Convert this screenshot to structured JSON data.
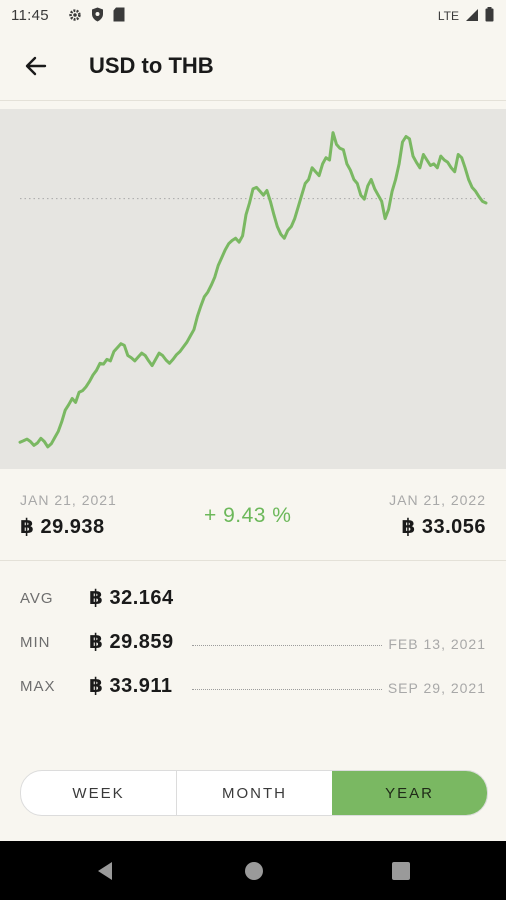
{
  "status_bar": {
    "time": "11:45",
    "network": "LTE",
    "icons": [
      "gear-icon",
      "shield-icon",
      "sd-card-icon",
      "signal-icon",
      "battery-icon"
    ]
  },
  "app_bar": {
    "title": "USD to THB",
    "back_icon": "arrow-left-icon"
  },
  "chart_data": {
    "type": "line",
    "title": "",
    "xlabel": "",
    "ylabel": "",
    "x_range": [
      "JAN 21, 2021",
      "JAN 21, 2022"
    ],
    "reference_line": 33.056,
    "color": "#7ab862",
    "series": [
      {
        "values": [
          29.94,
          29.96,
          29.98,
          29.95,
          29.9,
          29.93,
          29.99,
          29.95,
          29.88,
          29.92,
          30.0,
          30.08,
          30.2,
          30.35,
          30.42,
          30.5,
          30.45,
          30.58,
          30.6,
          30.65,
          30.72,
          30.8,
          30.86,
          30.95,
          30.94,
          31.0,
          30.98,
          31.1,
          31.15,
          31.2,
          31.18,
          31.05,
          31.02,
          30.98,
          31.03,
          31.08,
          31.05,
          30.98,
          30.92,
          31.0,
          31.08,
          31.05,
          30.99,
          30.95,
          31.0,
          31.06,
          31.1,
          31.16,
          31.22,
          31.3,
          31.38,
          31.55,
          31.68,
          31.8,
          31.86,
          31.95,
          32.05,
          32.2,
          32.3,
          32.4,
          32.48,
          32.52,
          32.55,
          32.5,
          32.58,
          32.85,
          33.0,
          33.18,
          33.2,
          33.15,
          33.1,
          33.16,
          33.02,
          32.85,
          32.7,
          32.6,
          32.55,
          32.65,
          32.7,
          32.8,
          32.95,
          33.1,
          33.25,
          33.3,
          33.45,
          33.4,
          33.35,
          33.5,
          33.58,
          33.55,
          33.9,
          33.75,
          33.7,
          33.68,
          33.5,
          33.42,
          33.3,
          33.25,
          33.1,
          33.05,
          33.22,
          33.3,
          33.18,
          33.1,
          33.02,
          32.8,
          32.92,
          33.15,
          33.3,
          33.5,
          33.78,
          33.85,
          33.82,
          33.6,
          33.52,
          33.45,
          33.62,
          33.55,
          33.48,
          33.5,
          33.45,
          33.6,
          33.55,
          33.52,
          33.45,
          33.4,
          33.62,
          33.58,
          33.45,
          33.3,
          33.2,
          33.15,
          33.08,
          33.02,
          33.0
        ]
      }
    ],
    "ylim": [
      29.7,
      34.1
    ],
    "grid": false,
    "legend": "none"
  },
  "summary": {
    "start_date": "JAN 21, 2021",
    "start_value": "฿ 29.938",
    "change": "+ 9.43 %",
    "change_color": "#6cb85a",
    "end_date": "JAN 21, 2022",
    "end_value": "฿ 33.056"
  },
  "stats": {
    "avg": {
      "label": "AVG",
      "value": "฿ 32.164"
    },
    "min": {
      "label": "MIN",
      "value": "฿ 29.859",
      "date": "FEB 13, 2021"
    },
    "max": {
      "label": "MAX",
      "value": "฿ 33.911",
      "date": "SEP 29, 2021"
    }
  },
  "period_selector": {
    "options": [
      "WEEK",
      "MONTH",
      "YEAR"
    ],
    "selected": "YEAR",
    "accent": "#7ab862"
  },
  "nav_bar": {
    "icons": [
      "back-triangle-icon",
      "home-circle-icon",
      "recents-square-icon"
    ]
  }
}
